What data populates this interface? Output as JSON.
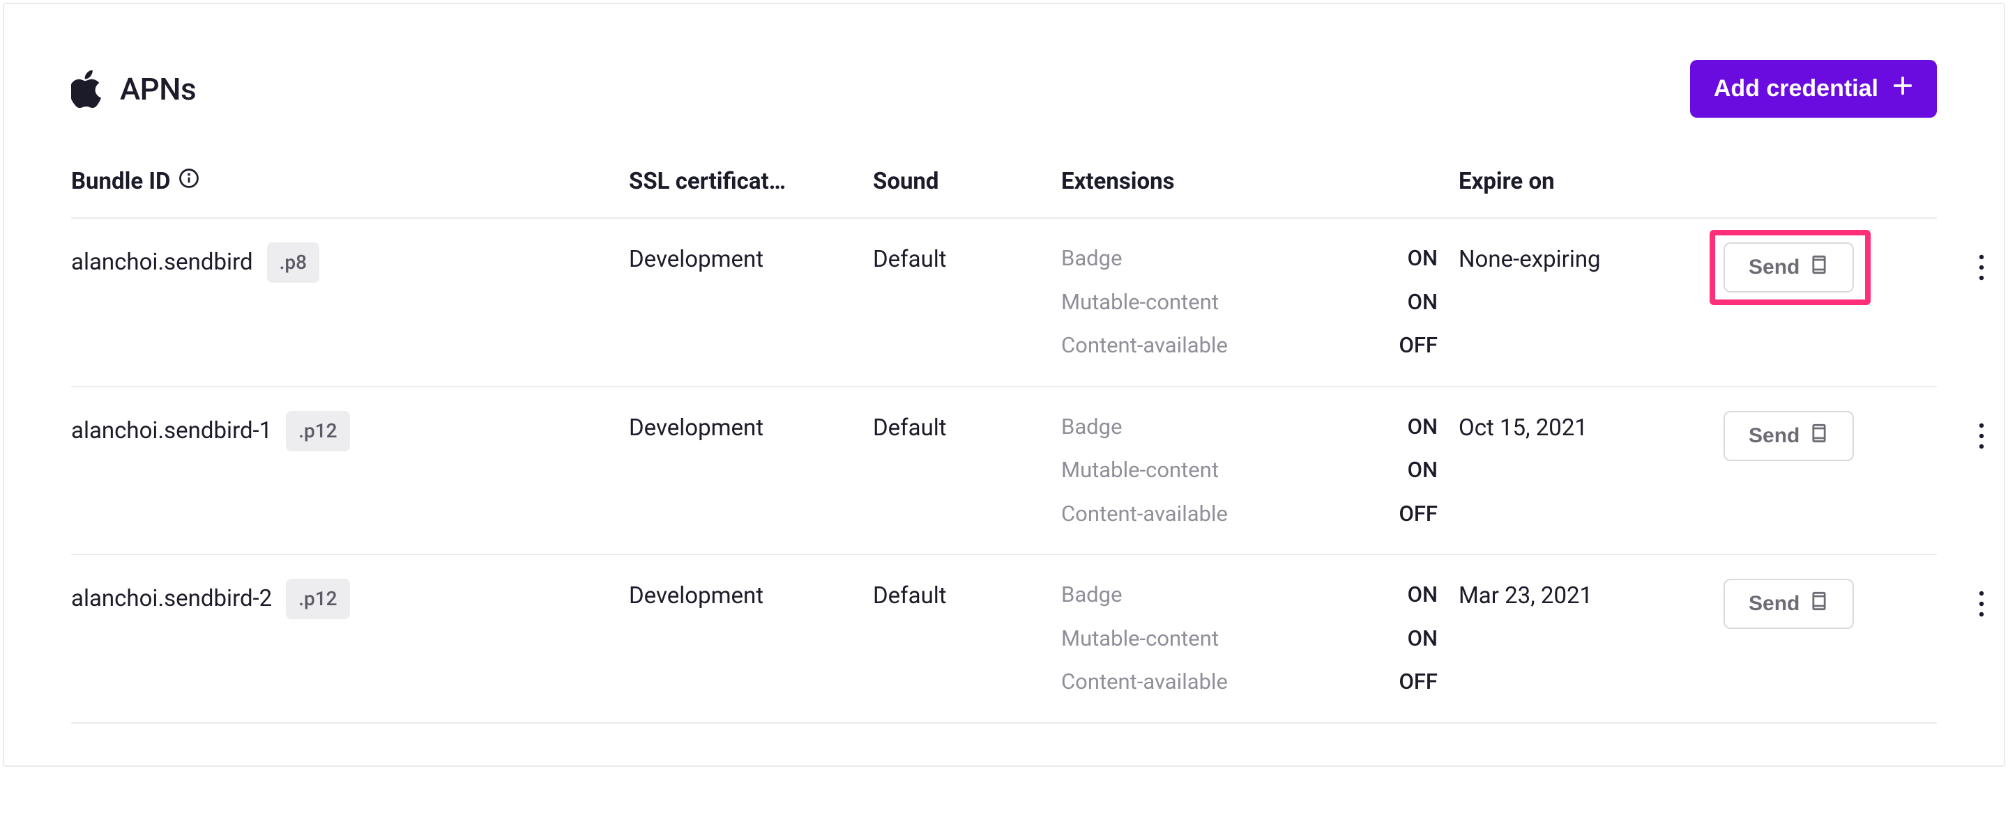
{
  "panel": {
    "title": "APNs",
    "add_button": "Add credential"
  },
  "columns": {
    "bundle_id": "Bundle ID",
    "ssl_cert": "SSL certificat…",
    "sound": "Sound",
    "extensions": "Extensions",
    "expire_on": "Expire on"
  },
  "ext_labels": {
    "badge": "Badge",
    "mutable": "Mutable-content",
    "content": "Content-available"
  },
  "send_label": "Send",
  "rows": [
    {
      "bundle_id": "alanchoi.sendbird",
      "ext_tag": ".p8",
      "ssl_cert": "Development",
      "sound": "Default",
      "badge": "ON",
      "mutable": "ON",
      "content": "OFF",
      "expire": "None-expiring",
      "highlight_send": true
    },
    {
      "bundle_id": "alanchoi.sendbird-1",
      "ext_tag": ".p12",
      "ssl_cert": "Development",
      "sound": "Default",
      "badge": "ON",
      "mutable": "ON",
      "content": "OFF",
      "expire": "Oct 15, 2021",
      "highlight_send": false
    },
    {
      "bundle_id": "alanchoi.sendbird-2",
      "ext_tag": ".p12",
      "ssl_cert": "Development",
      "sound": "Default",
      "badge": "ON",
      "mutable": "ON",
      "content": "OFF",
      "expire": "Mar 23, 2021",
      "highlight_send": false
    }
  ]
}
